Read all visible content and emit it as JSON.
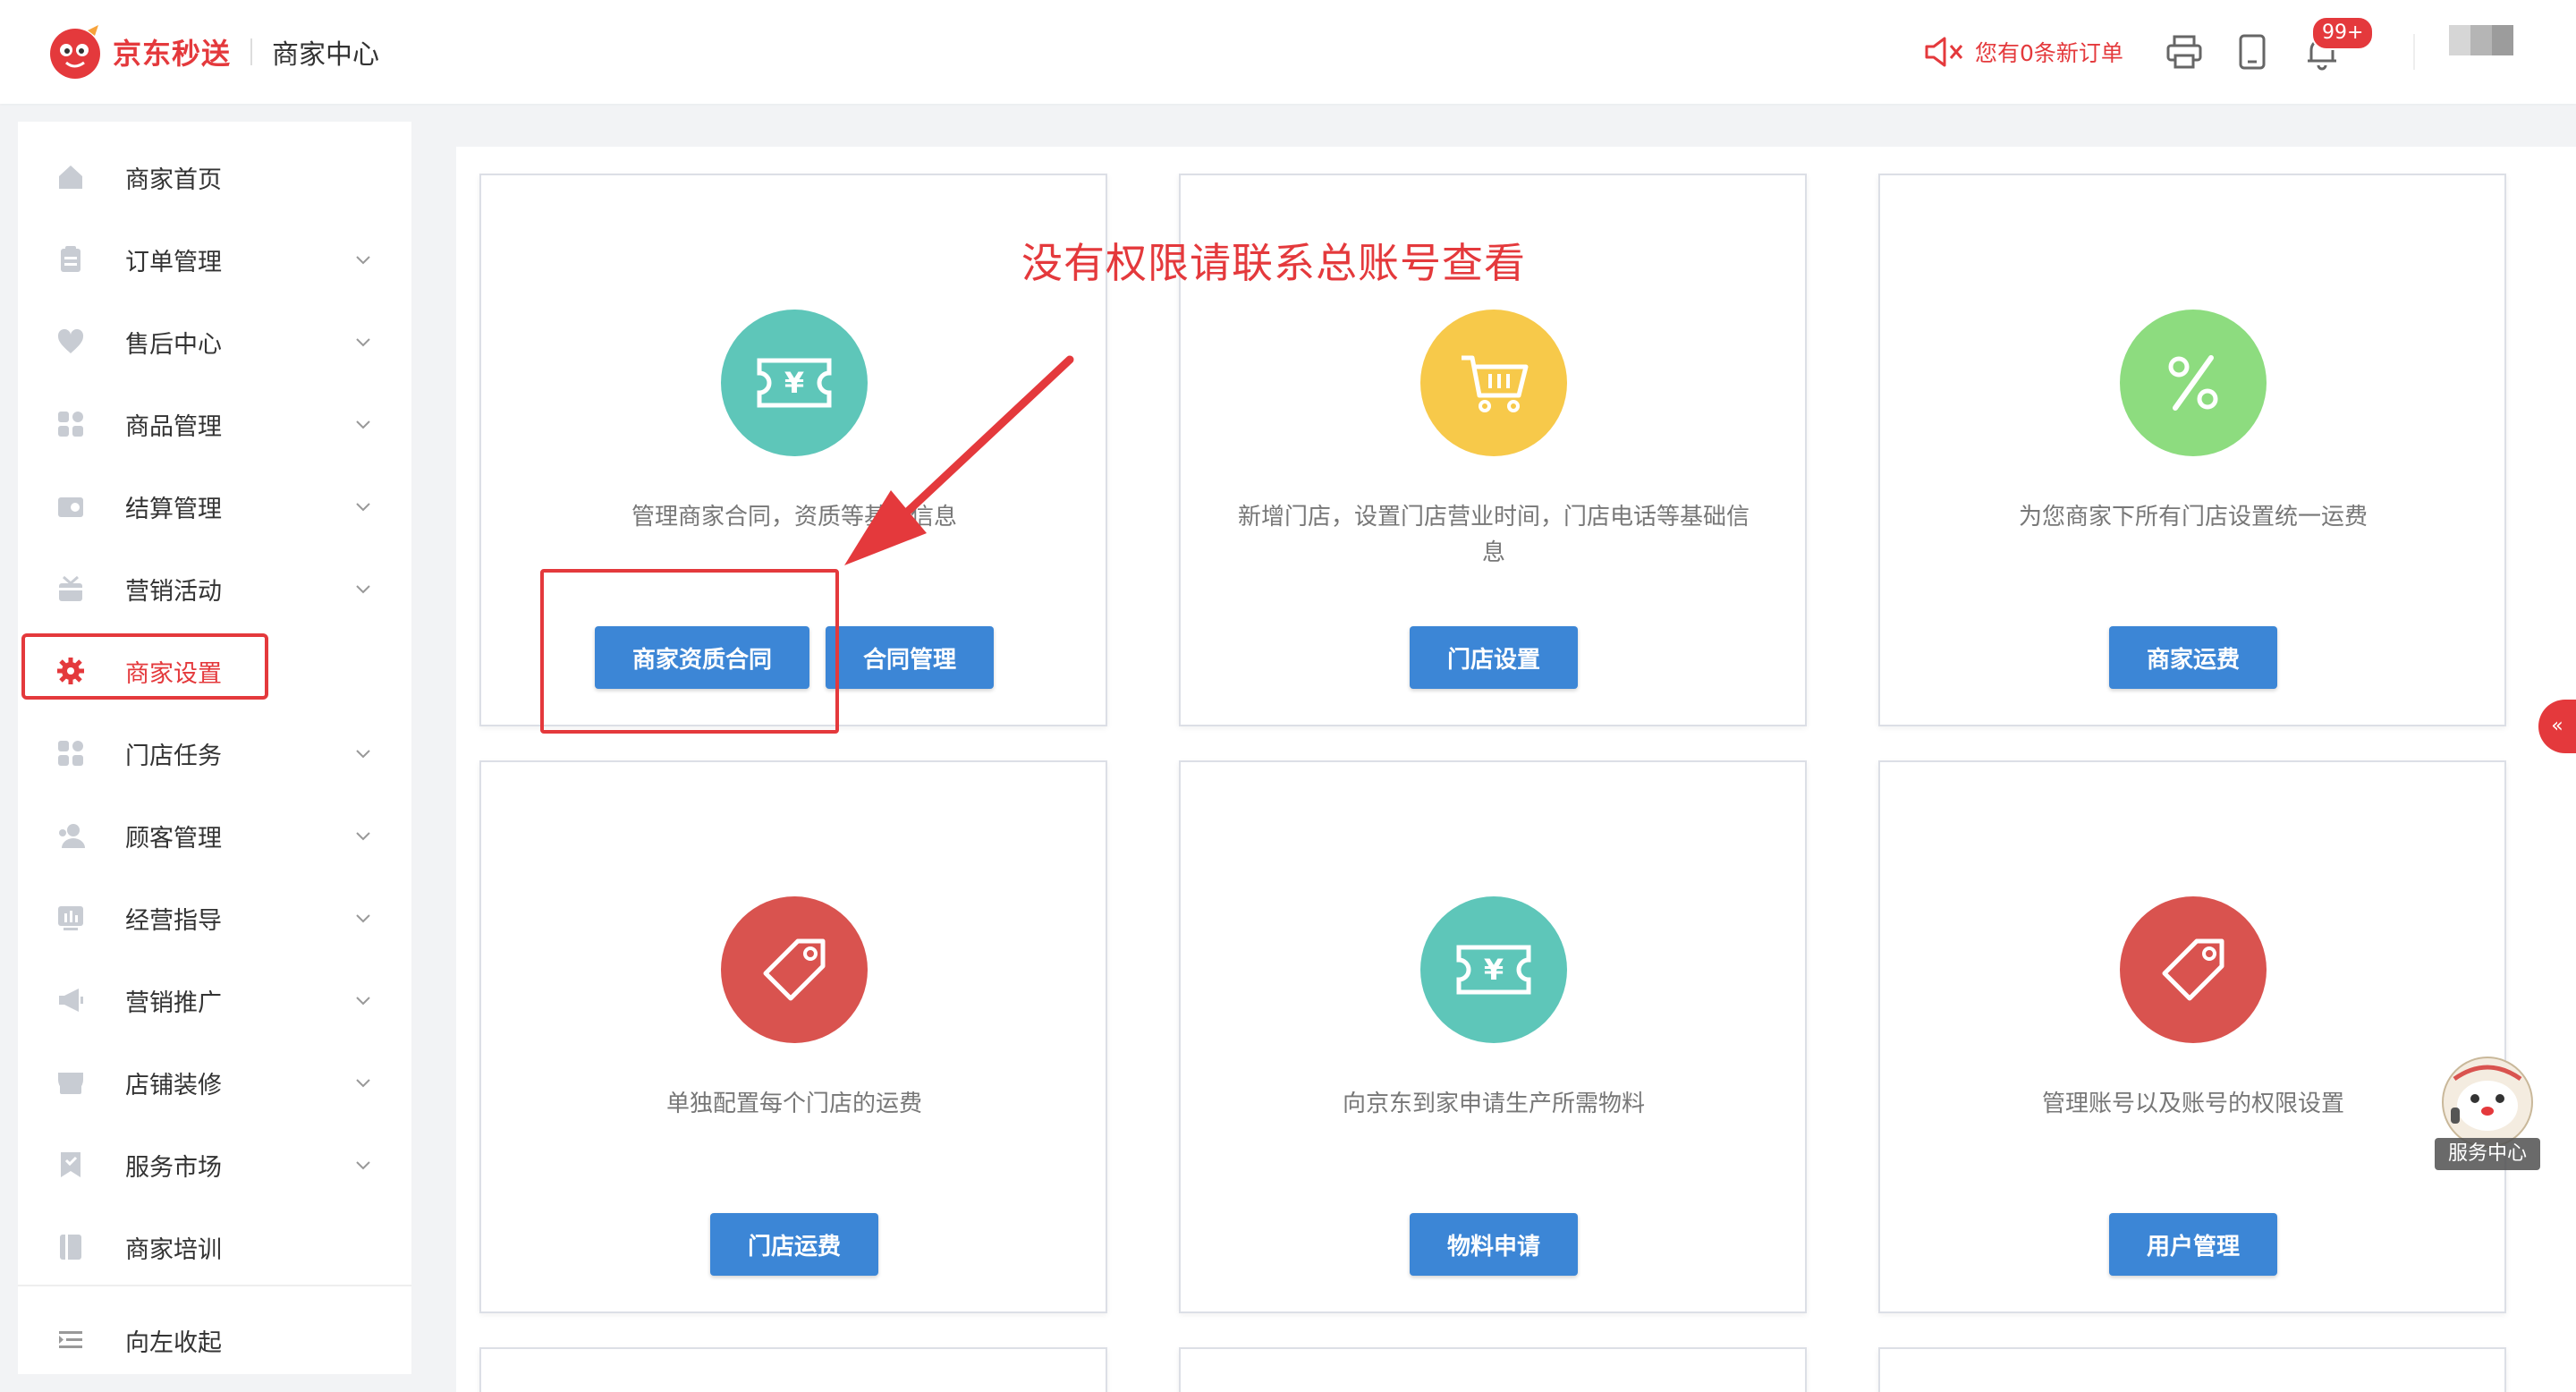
{
  "header": {
    "brand": "京东秒送",
    "subtitle": "商家中心",
    "new_order_text": "您有0条新订单",
    "notification_count": "99+",
    "colors": {
      "brand_red": "#e4393c",
      "primary_blue": "#3c86d6"
    }
  },
  "sidebar": {
    "items": [
      {
        "label": "商家首页",
        "icon": "home-icon",
        "caret": false
      },
      {
        "label": "订单管理",
        "icon": "clipboard-icon",
        "caret": true
      },
      {
        "label": "售后中心",
        "icon": "heart-shield-icon",
        "caret": true
      },
      {
        "label": "商品管理",
        "icon": "grid-icon",
        "caret": true
      },
      {
        "label": "结算管理",
        "icon": "wallet-icon",
        "caret": true
      },
      {
        "label": "营销活动",
        "icon": "gift-icon",
        "caret": true
      },
      {
        "label": "商家设置",
        "icon": "gear-icon",
        "caret": false,
        "active": true
      },
      {
        "label": "门店任务",
        "icon": "grid-icon",
        "caret": true
      },
      {
        "label": "顾客管理",
        "icon": "users-icon",
        "caret": true
      },
      {
        "label": "经营指导",
        "icon": "chart-icon",
        "caret": true
      },
      {
        "label": "营销推广",
        "icon": "megaphone-icon",
        "caret": true
      },
      {
        "label": "店铺装修",
        "icon": "store-icon",
        "caret": true
      },
      {
        "label": "服务市场",
        "icon": "bookmark-icon",
        "caret": true
      },
      {
        "label": "商家培训",
        "icon": "book-icon",
        "caret": false
      }
    ],
    "collapse_label": "向左收起"
  },
  "cards": [
    {
      "desc": "管理商家合同，资质等基本信息",
      "icon": "voucher-icon",
      "color": "#5ec6b9",
      "buttons": [
        "商家资质合同",
        "合同管理"
      ]
    },
    {
      "desc": "新增门店，设置门店营业时间，门店电话等基础信息",
      "icon": "cart-icon",
      "color": "#f7c94a",
      "buttons": [
        "门店设置"
      ]
    },
    {
      "desc": "为您商家下所有门店设置统一运费",
      "icon": "percent-icon",
      "color": "#8ddc7f",
      "buttons": [
        "商家运费"
      ]
    },
    {
      "desc": "单独配置每个门店的运费",
      "icon": "tag-icon",
      "color": "#d9534f",
      "buttons": [
        "门店运费"
      ]
    },
    {
      "desc": "向京东到家申请生产所需物料",
      "icon": "voucher-icon",
      "color": "#5ec6b9",
      "buttons": [
        "物料申请"
      ]
    },
    {
      "desc": "管理账号以及账号的权限设置",
      "icon": "tag-icon",
      "color": "#d9534f",
      "buttons": [
        "用户管理"
      ]
    }
  ],
  "annotation": {
    "text": "没有权限请联系总账号查看"
  },
  "side_tab": "«",
  "service_center": "服务中心"
}
